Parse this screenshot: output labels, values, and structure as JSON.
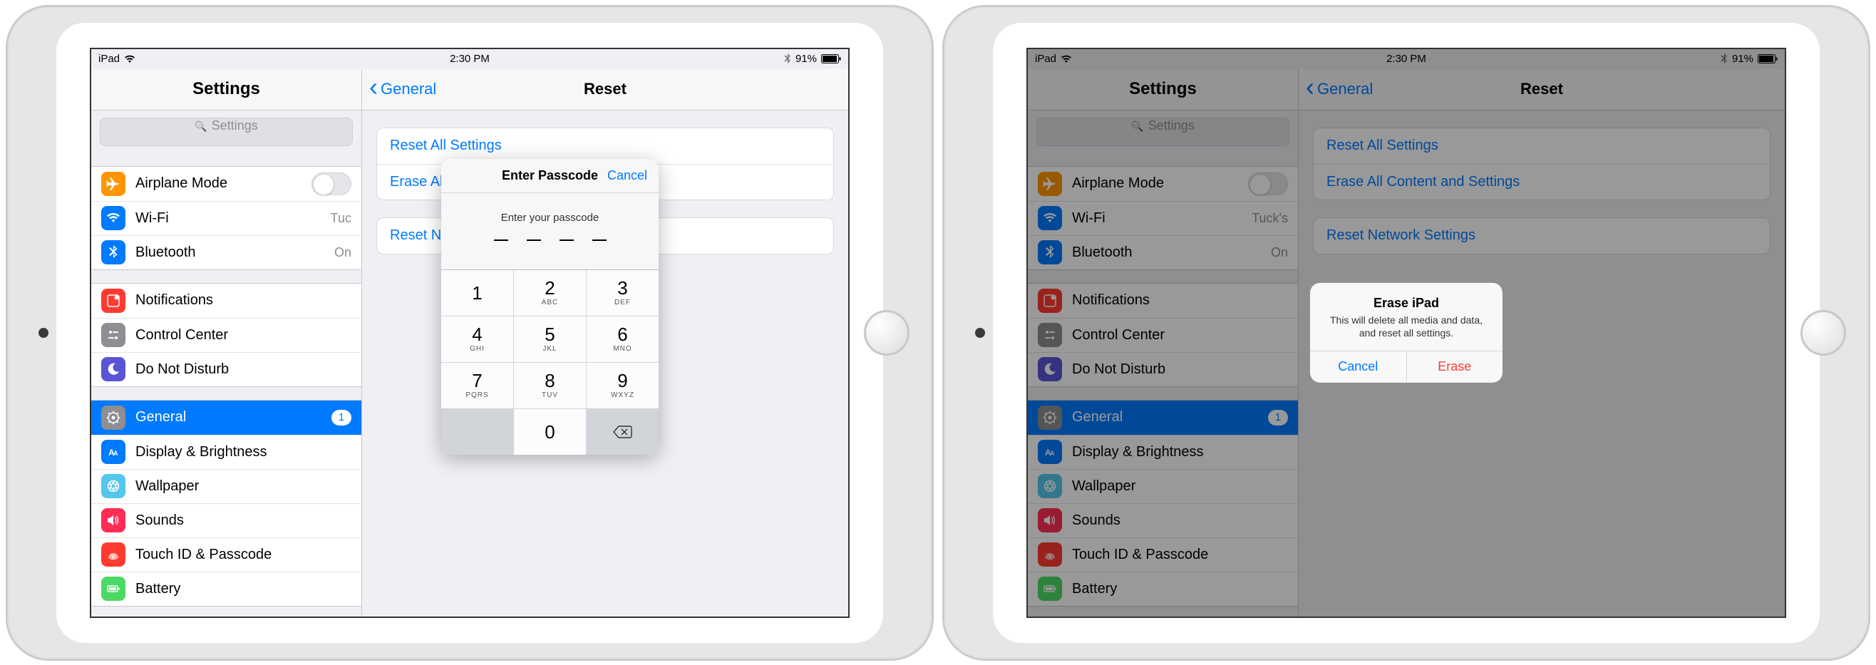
{
  "status": {
    "carrier": "iPad",
    "time": "2:30 PM",
    "battery_pct": "91%"
  },
  "sidebar": {
    "title": "Settings",
    "search_placeholder": "Settings",
    "groups": [
      [
        {
          "icon": "airplane",
          "color": "#ff9500",
          "label": "Airplane Mode",
          "toggle": true
        },
        {
          "icon": "wifi",
          "color": "#007aff",
          "label": "Wi-Fi",
          "value": "Tuck's"
        },
        {
          "icon": "bluetooth",
          "color": "#007aff",
          "label": "Bluetooth",
          "value": "On"
        }
      ],
      [
        {
          "icon": "notifications",
          "color": "#ff3b30",
          "label": "Notifications"
        },
        {
          "icon": "control",
          "color": "#8e8e93",
          "label": "Control Center"
        },
        {
          "icon": "dnd",
          "color": "#5856d6",
          "label": "Do Not Disturb"
        }
      ],
      [
        {
          "icon": "general",
          "color": "#8e8e93",
          "label": "General",
          "selected": true,
          "badge": "1"
        },
        {
          "icon": "display",
          "color": "#007aff",
          "label": "Display & Brightness"
        },
        {
          "icon": "wallpaper",
          "color": "#54c7ec",
          "label": "Wallpaper"
        },
        {
          "icon": "sounds",
          "color": "#ff2d55",
          "label": "Sounds"
        },
        {
          "icon": "touchid",
          "color": "#ff3b30",
          "label": "Touch ID & Passcode"
        },
        {
          "icon": "battery",
          "color": "#4cd964",
          "label": "Battery"
        }
      ]
    ]
  },
  "detail": {
    "back": "General",
    "title": "Reset",
    "groups": [
      [
        "Reset All Settings",
        "Erase All Content and Settings"
      ],
      [
        "Reset Network Settings"
      ]
    ]
  },
  "passcode": {
    "title": "Enter Passcode",
    "cancel": "Cancel",
    "prompt": "Enter your passcode",
    "keys": [
      {
        "n": "1",
        "l": ""
      },
      {
        "n": "2",
        "l": "ABC"
      },
      {
        "n": "3",
        "l": "DEF"
      },
      {
        "n": "4",
        "l": "GHI"
      },
      {
        "n": "5",
        "l": "JKL"
      },
      {
        "n": "6",
        "l": "MNO"
      },
      {
        "n": "7",
        "l": "PQRS"
      },
      {
        "n": "8",
        "l": "TUV"
      },
      {
        "n": "9",
        "l": "WXYZ"
      },
      {
        "blank": true
      },
      {
        "n": "0",
        "l": ""
      },
      {
        "del": true
      }
    ]
  },
  "alert": {
    "title": "Erase iPad",
    "msg": "This will delete all media and data, and reset all settings.",
    "cancel": "Cancel",
    "confirm": "Erase"
  },
  "left_wifi_value": "Tuc"
}
